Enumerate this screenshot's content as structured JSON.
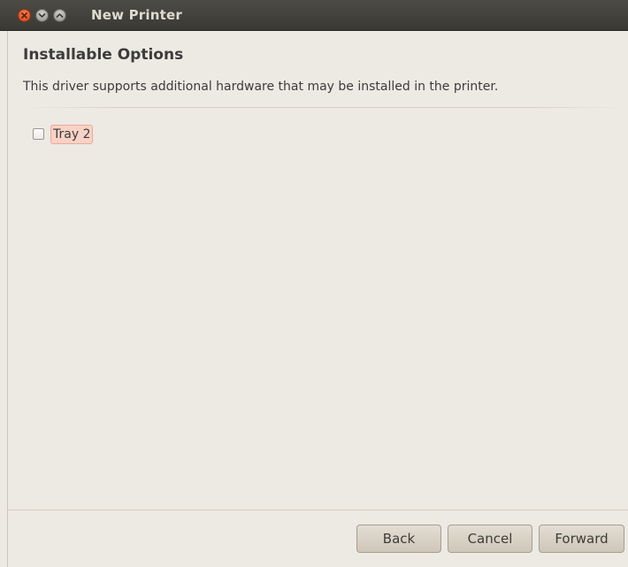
{
  "window": {
    "title": "New Printer"
  },
  "page": {
    "heading": "Installable Options",
    "description": "This driver supports additional hardware that may be installed in the printer."
  },
  "options": [
    {
      "label": "Tray 2",
      "checked": false
    }
  ],
  "buttons": {
    "back": "Back",
    "cancel": "Cancel",
    "forward": "Forward"
  },
  "colors": {
    "close_button": "#e35a26",
    "titlebar": "#3c3b37",
    "background": "#ede9e3",
    "focus_highlight": "#f8d2c6"
  },
  "icons": {
    "close": "close-icon",
    "minimize": "minimize-icon",
    "maximize": "maximize-icon"
  }
}
